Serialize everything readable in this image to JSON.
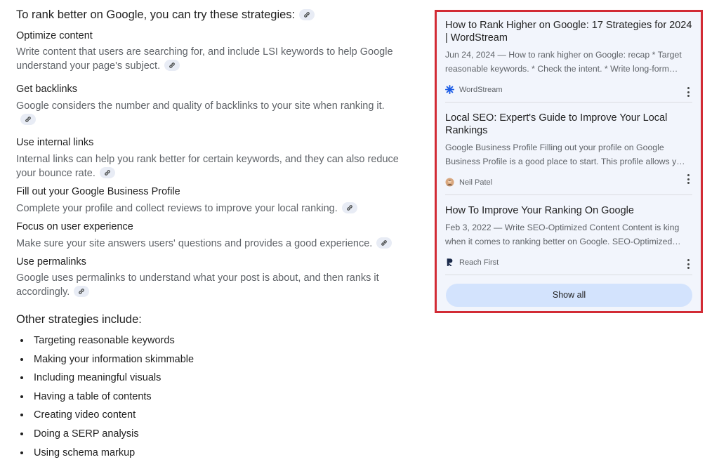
{
  "overview": {
    "intro": "To rank better on Google, you can try these strategies:",
    "sections": [
      {
        "title": "Optimize content",
        "body": "Write content that users are searching for, and include LSI keywords to help Google understand your page's subject."
      },
      {
        "title": "Get backlinks",
        "body": "Google considers the number and quality of backlinks to your site when ranking it."
      },
      {
        "title": "Use internal links",
        "body": "Internal links can help you rank better for certain keywords, and they can also reduce your bounce rate."
      },
      {
        "title": "Fill out your Google Business Profile",
        "body": "Complete your profile and collect reviews to improve your local ranking."
      },
      {
        "title": "Focus on user experience",
        "body": "Make sure your site answers users' questions and provides a good experience."
      },
      {
        "title": "Use permalinks",
        "body": "Google uses permalinks to understand what your post is about, and then ranks it accordingly."
      }
    ],
    "other_heading": "Other strategies include:",
    "other_items": [
      "Targeting reasonable keywords",
      "Making your information skimmable",
      "Including meaningful visuals",
      "Having a table of contents",
      "Creating video content",
      "Doing a SERP analysis",
      "Using schema markup"
    ]
  },
  "sources": {
    "cards": [
      {
        "title": "How to Rank Higher on Google: 17 Strategies for 2024 | WordStream",
        "snippet": "Jun 24, 2024 — How to rank higher on Google: recap * Target reasonable keywords. * Check the intent. * Write long-form…",
        "source": "WordStream",
        "logo_icon": "wordstream-logo-icon",
        "logo_color": "#1a5be6"
      },
      {
        "title": "Local SEO: Expert's Guide to Improve Your Local Rankings",
        "snippet": "Google Business Profile Filling out your profile on Google Business Profile is a good place to start. This profile allows y…",
        "source": "Neil Patel",
        "logo_icon": "neil-patel-avatar-icon",
        "logo_color": "#d9a77e"
      },
      {
        "title": "How To Improve Your Ranking On Google",
        "snippet": "Feb 3, 2022 — Write SEO-Optimized Content Content is king when it comes to ranking better on Google. SEO-Optimized…",
        "source": "Reach First",
        "logo_icon": "reach-first-logo-icon",
        "logo_color": "#1b2a4a"
      }
    ],
    "show_all_label": "Show all",
    "highlight_color": "#d22b35"
  }
}
